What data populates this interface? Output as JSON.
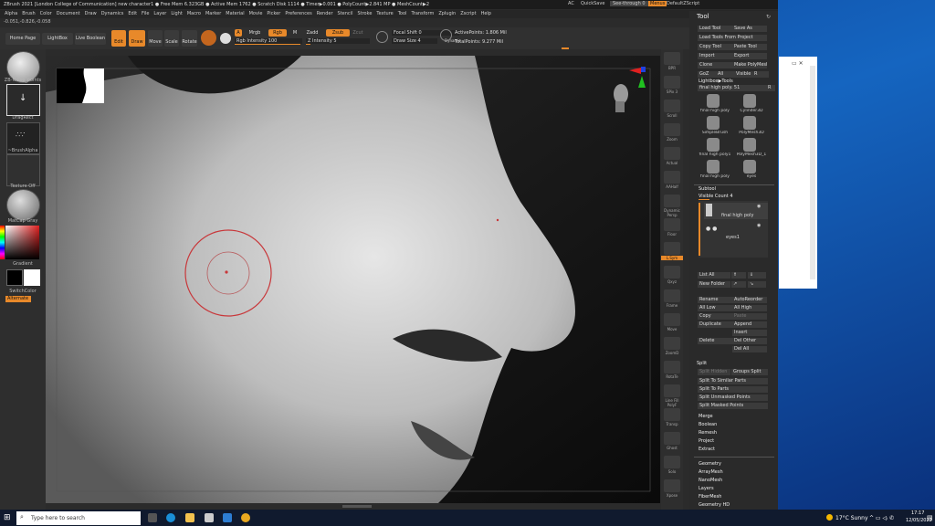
{
  "window_title": "ZBrush 2021 [London College of Communication]   new character1   ● Free Mem 6.323GB ● Active Mem 1762 ● Scratch Disk 1114 ● Timer▶0.001 ● PolyCount▶2.841 MP ● MeshCount▶2",
  "top_right": {
    "ac": "AC",
    "quicksave": "QuickSave",
    "seethrough": "See-through  0",
    "menus": "Menus",
    "script": "DefaultZScript"
  },
  "menu_items": [
    "Alpha",
    "Brush",
    "Color",
    "Document",
    "Draw",
    "Dynamics",
    "Edit",
    "File",
    "Layer",
    "Light",
    "Macro",
    "Marker",
    "Material",
    "Movie",
    "Picker",
    "Preferences",
    "Render",
    "Stencil",
    "Stroke",
    "Texture",
    "Tool",
    "Transform",
    "Zplugin",
    "Zscript",
    "Help"
  ],
  "coords": "-0.051,-0.826,-0.058",
  "toolbar": {
    "home_page": "Home Page",
    "lightbox": "LightBox",
    "live_boolean": "Live Boolean",
    "edit": "Edit",
    "draw": "Draw",
    "move": "Move",
    "scale": "Scale",
    "rotate": "Rotate",
    "a": "A",
    "mrgb": "Mrgb",
    "rgb": "Rgb",
    "m": "M",
    "zadd": "Zadd",
    "zsub": "Zsub",
    "zcut": "Zcut",
    "rgb_intensity": "Rgb Intensity 100",
    "z_intensity": "Z Intensity 5",
    "focal_shift": "Focal Shift 0",
    "draw_size": "Draw Size 4",
    "dynamic": "Dynamic",
    "active_points": "ActivePoints: 1.806 Mil",
    "total_points": "TotalPoints: 9.277 Mil"
  },
  "left_shelf": {
    "brush_label": "ZB-Noise_points",
    "stroke_label": "DragRect",
    "alpha_label": "~BrushAlpha",
    "texture_label": "Texture Off",
    "material_label": "MatCap Gray",
    "gradient_label": "Gradient",
    "switch_label": "SwitchColor",
    "alternate_label": "Alternate"
  },
  "right_shelf": [
    "BPR",
    "SPix 3",
    "Scroll",
    "Zoom",
    "Actual",
    "AAHalf",
    "Dynamic Persp",
    "Floor",
    "L.Sym",
    "Qxyz",
    "Frame",
    "Move",
    "ZoomD",
    "RotaTe",
    "Line Fill PolyF",
    "Transp",
    "Ghost",
    "Solo",
    "Xpose"
  ],
  "tool_panel": {
    "title": "Tool",
    "buttons": [
      [
        "Load Tool",
        "Save As"
      ],
      [
        "Load Tools From Project"
      ],
      [
        "Copy Tool",
        "Paste Tool"
      ],
      [
        "Import",
        "Export"
      ],
      [
        "Clone",
        "Make PolyMesh3D"
      ],
      [
        "GoZ",
        "All",
        "Visible",
        "R"
      ]
    ],
    "lightbox_tools": "Lightbox▶Tools",
    "current_tool": "final high poly. 51",
    "current_tool_value": "R",
    "tool_thumbs": [
      "final high poly",
      "Cylinder3D",
      "SimpleBrush",
      "PolyMesh3D",
      "final high poly1",
      "PolyMesh3D_1",
      "final high poly",
      "eyes"
    ],
    "subtool_header": "Subtool",
    "visible_count": "Visible Count 4",
    "subtools": [
      "final high poly",
      "eyes1"
    ],
    "list_all": "List All",
    "new_folder": "New Folder",
    "ops": [
      [
        "Rename",
        "AutoReorder"
      ],
      [
        "All Low",
        "All High"
      ],
      [
        "Copy",
        "Paste"
      ],
      [
        "Duplicate",
        "Append"
      ],
      [
        "",
        "Insert"
      ],
      [
        "Delete",
        "Del Other"
      ],
      [
        "",
        "Del All"
      ]
    ],
    "split_header": "Split",
    "split_hidden": "Split Hidden",
    "groups_split": "Groups Split",
    "split_items": [
      "Split To Similar Parts",
      "Split To Parts",
      "Split Unmasked Points",
      "Split Masked Points"
    ],
    "sections": [
      "Merge",
      "Boolean",
      "Remesh",
      "Project",
      "Extract"
    ],
    "lower_sections": [
      "Geometry",
      "ArrayMesh",
      "NanoMesh",
      "Layers",
      "FiberMesh",
      "Geometry HD"
    ]
  },
  "taskbar": {
    "search_placeholder": "Type here to search",
    "weather": "17°C  Sunny",
    "time": "17:17",
    "date": "12/05/2022"
  },
  "colors": {
    "accent": "#e8892a",
    "brush_ring": "#c8373a"
  }
}
